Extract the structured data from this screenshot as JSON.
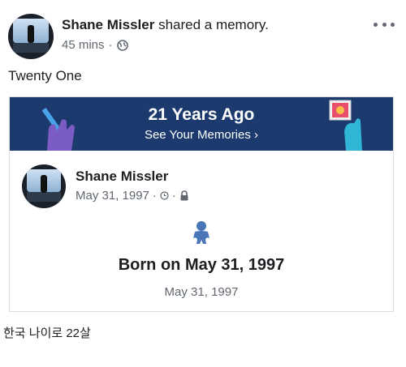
{
  "post": {
    "author": "Shane Missler",
    "action": "shared a memory.",
    "time": "45 mins",
    "separator": "·",
    "privacy_icon": "globe-icon",
    "more_icon": "more-options-icon",
    "text": "Twenty One"
  },
  "memory": {
    "banner_title": "21 Years Ago",
    "banner_link": "See Your Memories",
    "banner_link_icon": "chevron-right-icon",
    "banner_color": "#1c3a6e",
    "author": "Shane Missler",
    "date": "May 31, 1997",
    "separator": "·",
    "event_icon": "baby-icon",
    "event_title": "Born on May 31, 1997",
    "event_date": "May 31, 1997"
  },
  "caption": "한국 나이로 22살"
}
